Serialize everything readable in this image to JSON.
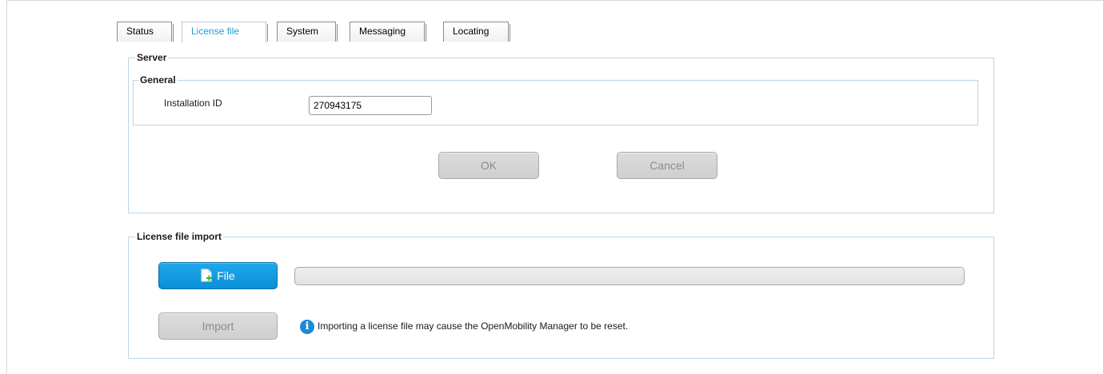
{
  "tabs": [
    {
      "label": "Status",
      "active": false
    },
    {
      "label": "License file",
      "active": true
    },
    {
      "label": "System",
      "active": false
    },
    {
      "label": "Messaging",
      "active": false
    },
    {
      "label": "Locating",
      "active": false
    }
  ],
  "server": {
    "title": "Server",
    "general": {
      "title": "General",
      "installation_id_label": "Installation ID",
      "installation_id_value": "270943175"
    },
    "ok_label": "OK",
    "cancel_label": "Cancel"
  },
  "license_import": {
    "title": "License file import",
    "file_button_label": "File",
    "progress_fraction": 0,
    "import_button_label": "Import",
    "info_text": "Importing a license file may cause the OpenMobility Manager to be reset."
  },
  "colors": {
    "accent": "#1a9fd6",
    "group_border": "#b9d5e8",
    "primary_button": "#0a8fd6",
    "disabled_button": "#cfcfcf"
  },
  "icons": {
    "file_button_icon": "file-add-icon",
    "info_icon": "info-icon"
  }
}
